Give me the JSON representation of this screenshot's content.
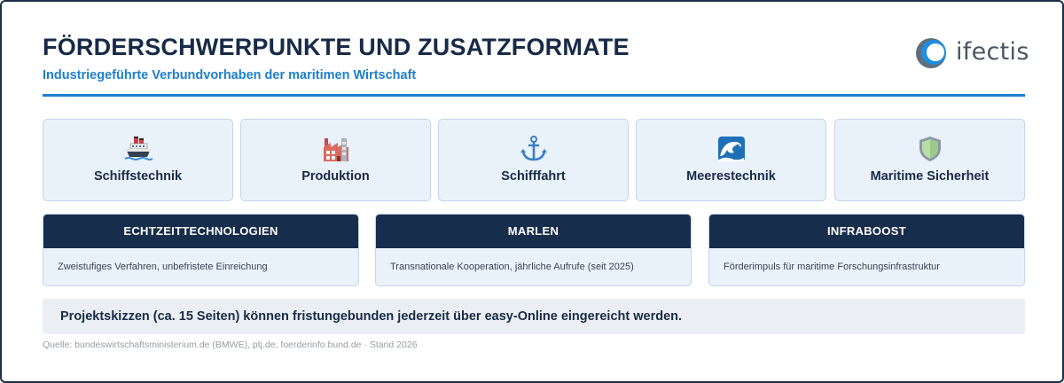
{
  "header": {
    "title": "FÖRDERSCHWERPUNKTE UND ZUSATZFORMATE",
    "subtitle": "Industriegeführte Verbundvorhaben der maritimen Wirtschaft",
    "logo_text": "ifectis",
    "logo_icon": "ifectis-logo-icon"
  },
  "focus_areas": [
    {
      "label": "Schiffstechnik",
      "icon": "ship-icon"
    },
    {
      "label": "Produktion",
      "icon": "factory-icon"
    },
    {
      "label": "Schifffahrt",
      "icon": "anchor-icon"
    },
    {
      "label": "Meerestechnik",
      "icon": "wave-icon"
    },
    {
      "label": "Maritime Sicherheit",
      "icon": "shield-icon"
    }
  ],
  "formats": [
    {
      "title": "ECHTZEITTECHNOLOGIEN",
      "description": "Zweistufiges Verfahren, unbefristete Einreichung"
    },
    {
      "title": "MARLEN",
      "description": "Transnationale Kooperation, jährliche Aufrufe (seit 2025)"
    },
    {
      "title": "INFRABOOST",
      "description": "Förderimpuls für maritime Forschungsinfrastruktur"
    }
  ],
  "note": "Projektskizzen (ca. 15 Seiten) können fristungebunden jederzeit über easy-Online eingereicht werden.",
  "source": "Quelle: bundeswirtschaftsministerium.de (BMWE), ptj.de, foerderinfo.bund.de · Stand 2026",
  "colors": {
    "navy": "#172d4c",
    "accent_blue": "#1d7fd0",
    "card_bg": "#e9f1fb",
    "note_bg": "#ebeff3"
  }
}
